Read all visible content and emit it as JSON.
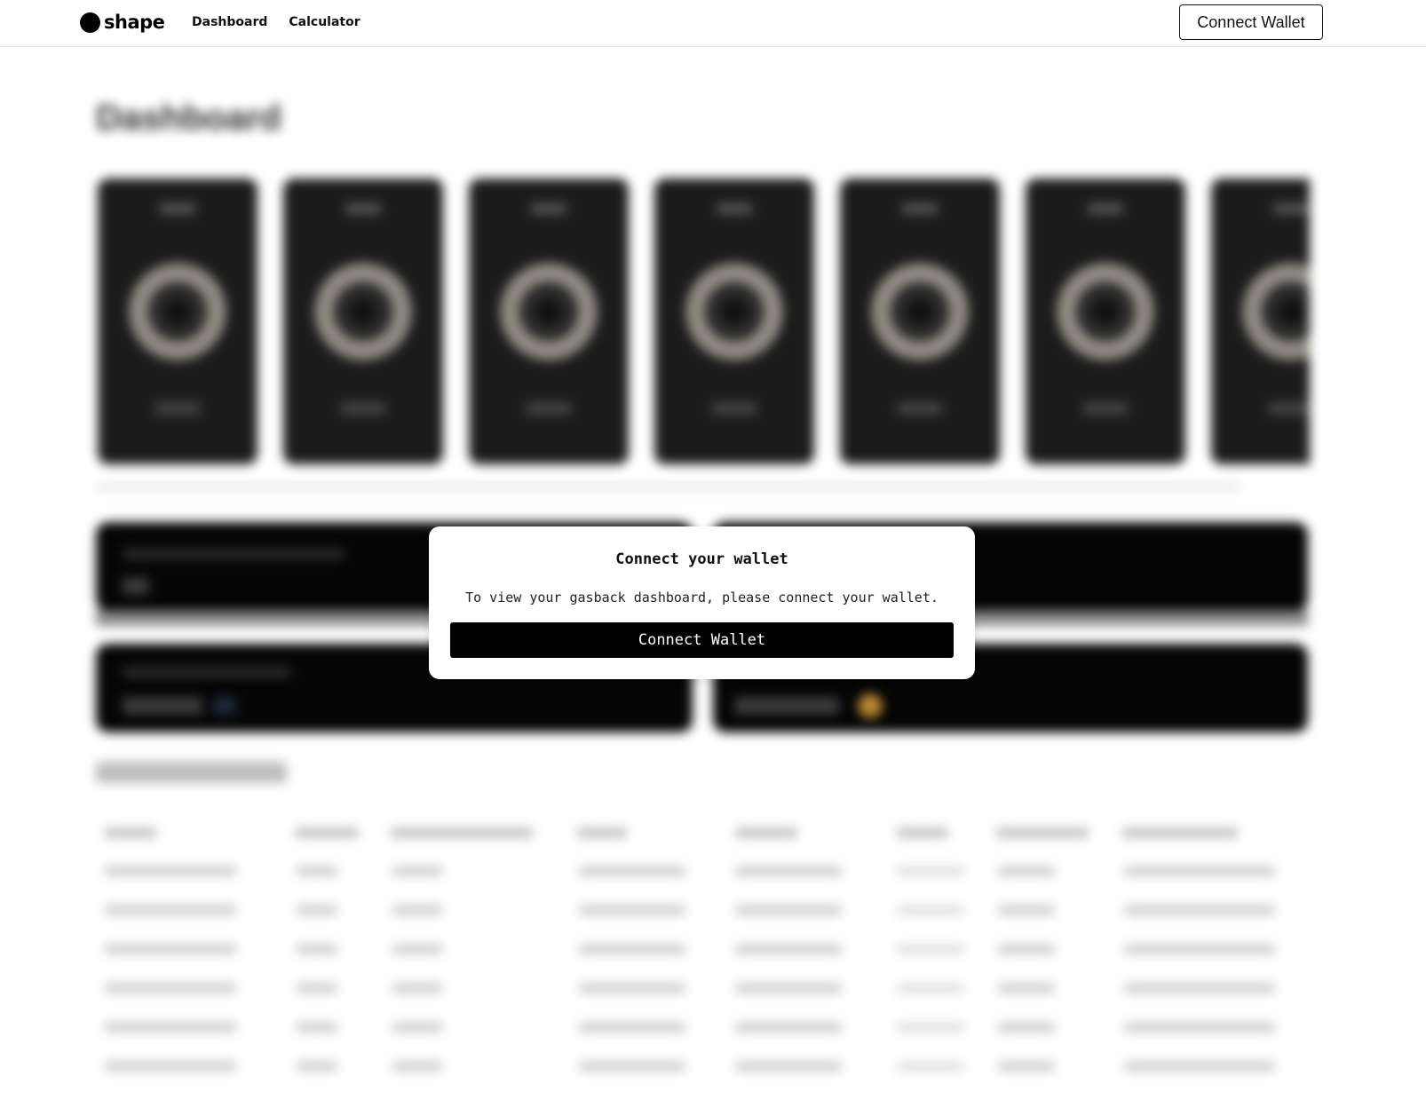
{
  "header": {
    "logo_text": "shape",
    "nav": [
      {
        "label": "Dashboard"
      },
      {
        "label": "Calculator"
      }
    ],
    "connect_label": "Connect Wallet"
  },
  "modal": {
    "title": "Connect your wallet",
    "description": "To view your gasback dashboard, please connect your wallet.",
    "button_label": "Connect Wallet"
  },
  "background": {
    "obscured": true,
    "card_count": 7,
    "panel_count": 4,
    "table_rows": 6,
    "table_columns": 8
  },
  "colors": {
    "primary": "#000000",
    "card_bg": "#1c1c1c",
    "accent_coin": "#b8862f",
    "page_bg": "#ffffff"
  }
}
